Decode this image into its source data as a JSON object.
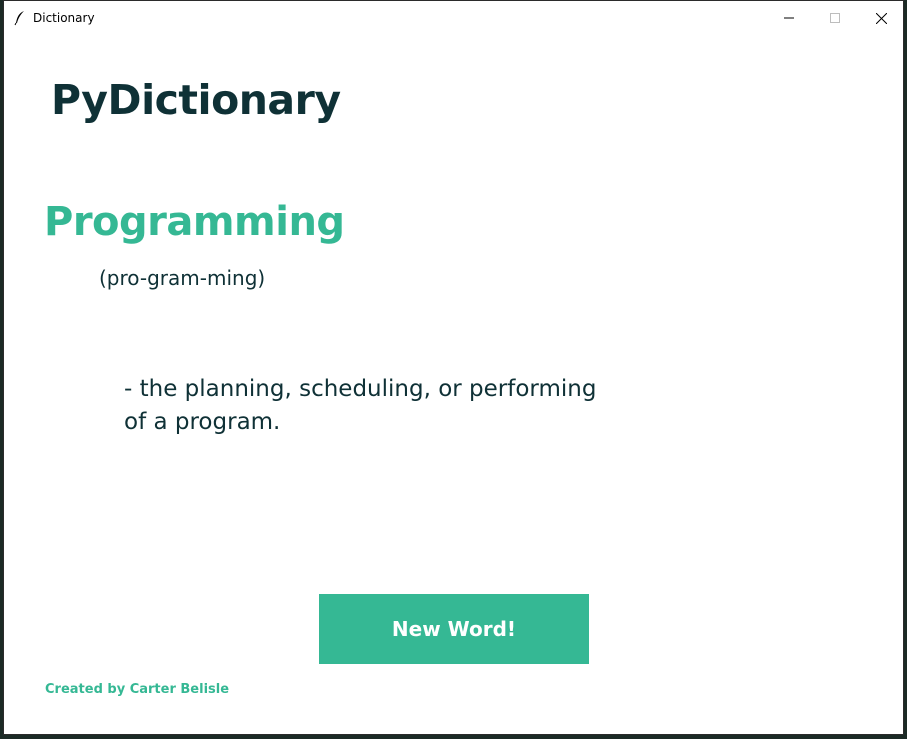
{
  "window": {
    "title": "Dictionary",
    "app_icon": "feather-icon",
    "controls": {
      "minimize": "minimize-icon",
      "maximize": "maximize-icon",
      "close": "close-icon"
    }
  },
  "app": {
    "title": "PyDictionary",
    "word": "Programming",
    "pronunciation": "(pro-gram-ming)",
    "definition": "- the planning, scheduling, or performing of a program.",
    "new_word_button": "New Word!",
    "credit": "Created by Carter Belisle"
  },
  "colors": {
    "accent": "#35b894",
    "text_dark": "#0f3136",
    "background": "#ffffff"
  }
}
